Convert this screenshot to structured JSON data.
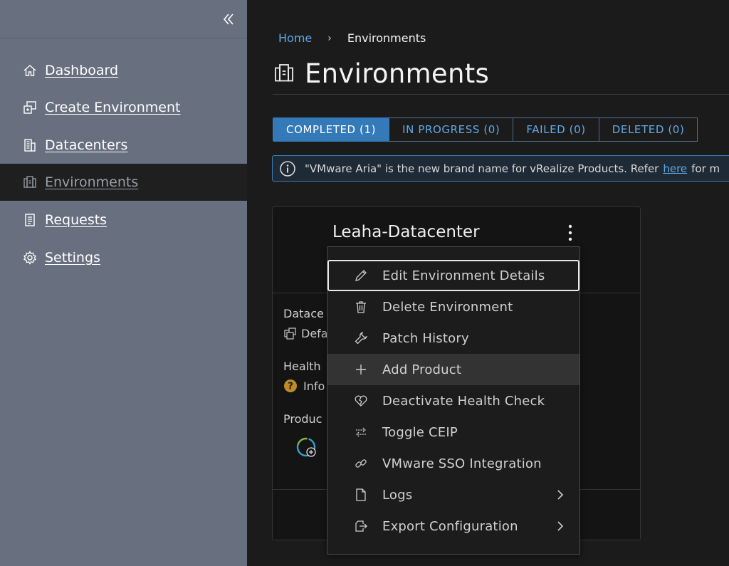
{
  "sidebar": {
    "items": [
      {
        "label": "Dashboard",
        "icon": "home-icon"
      },
      {
        "label": "Create Environment",
        "icon": "create-environment-icon"
      },
      {
        "label": "Datacenters",
        "icon": "building-icon"
      },
      {
        "label": "Environments",
        "icon": "environment-icon",
        "active": true
      },
      {
        "label": "Requests",
        "icon": "requests-icon"
      },
      {
        "label": "Settings",
        "icon": "gear-icon"
      }
    ]
  },
  "breadcrumb": {
    "home": "Home",
    "separator": "›",
    "current": "Environments"
  },
  "page": {
    "title": "Environments"
  },
  "tabs": [
    {
      "label": "COMPLETED (1)",
      "active": true
    },
    {
      "label": "IN PROGRESS (0)"
    },
    {
      "label": "FAILED (0)"
    },
    {
      "label": "DELETED (0)"
    }
  ],
  "banner": {
    "text": "\"VMware Aria\" is the new brand name for vRealize Products. Refer",
    "link": "here",
    "tail": "for m"
  },
  "card": {
    "title": "Leaha-Datacenter",
    "datacenter_label": "Datace",
    "datacenter_value": "Defa",
    "health_label": "Health",
    "health_value": "Info",
    "products_label": "Produc"
  },
  "menu": {
    "items": [
      {
        "label": "Edit Environment Details",
        "icon": "pencil-icon"
      },
      {
        "label": "Delete Environment",
        "icon": "trash-icon"
      },
      {
        "label": "Patch History",
        "icon": "wrench-icon"
      },
      {
        "label": "Add Product",
        "icon": "plus-icon"
      },
      {
        "label": "Deactivate Health Check",
        "icon": "broken-heart-icon"
      },
      {
        "label": "Toggle CEIP",
        "icon": "toggle-arrows-icon"
      },
      {
        "label": "VMware SSO Integration",
        "icon": "link-icon"
      },
      {
        "label": "Logs",
        "icon": "file-icon",
        "submenu": true
      },
      {
        "label": "Export Configuration",
        "icon": "export-icon",
        "submenu": true
      }
    ]
  },
  "colors": {
    "sidebar_bg": "#687080",
    "accent": "#3479b8",
    "link": "#5ea8e6",
    "warning": "#c18a24"
  }
}
